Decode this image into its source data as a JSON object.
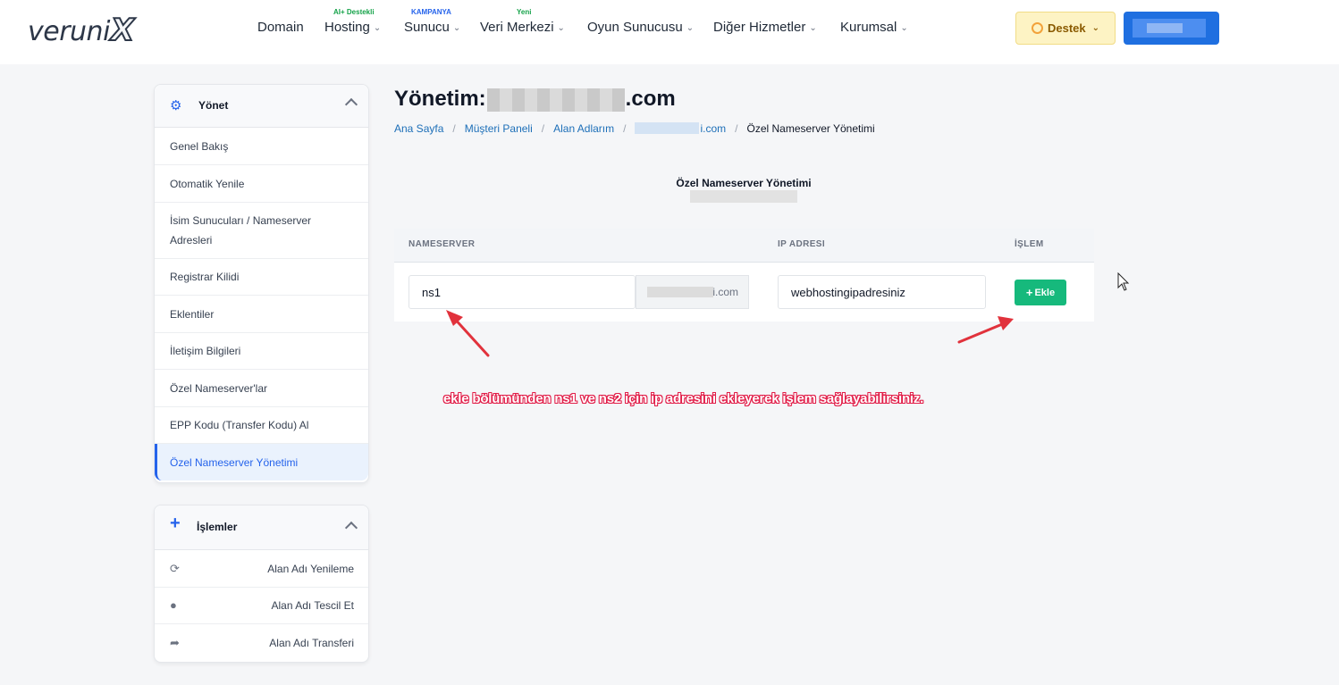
{
  "header": {
    "logo_text": "veruni",
    "logo_x": "X",
    "nav": [
      {
        "label": "Domain",
        "badge": ""
      },
      {
        "label": "Hosting",
        "badge": "AI+ Destekli",
        "badge_color": "#16a34a"
      },
      {
        "label": "Sunucu",
        "badge": "KAMPANYA",
        "badge_color": "#2563eb"
      },
      {
        "label": "Veri Merkezi",
        "badge": "Yeni",
        "badge_color": "#16a34a"
      },
      {
        "label": "Oyun Sunucusu",
        "badge": ""
      },
      {
        "label": "Diğer Hizmetler",
        "badge": ""
      },
      {
        "label": "Kurumsal",
        "badge": ""
      }
    ],
    "support_label": "Destek",
    "user_label": ""
  },
  "sidebar": {
    "manage": {
      "title": "Yönet",
      "items": [
        {
          "label": "Genel Bakış"
        },
        {
          "label": "Otomatik Yenile"
        },
        {
          "label": "İsim Sunucuları / Nameserver Adresleri"
        },
        {
          "label": "Registrar Kilidi"
        },
        {
          "label": "Eklentiler"
        },
        {
          "label": "İletişim Bilgileri"
        },
        {
          "label": "Özel Nameserver'lar"
        },
        {
          "label": "EPP Kodu (Transfer Kodu) Al"
        },
        {
          "label": "Özel Nameserver Yönetimi",
          "active": true
        }
      ]
    },
    "actions": {
      "title": "İşlemler",
      "items": [
        {
          "label": "Alan Adı Yenileme",
          "icon": "refresh-icon"
        },
        {
          "label": "Alan Adı Tescil Et",
          "icon": "globe-icon"
        },
        {
          "label": "Alan Adı Transferi",
          "icon": "share-icon"
        }
      ]
    }
  },
  "main": {
    "title_prefix": "Yönetim:",
    "title_suffix": ".com",
    "breadcrumb": {
      "home": "Ana Sayfa",
      "panel": "Müşteri Paneli",
      "domains": "Alan Adlarım",
      "domain_suffix": "i.com",
      "current": "Özel Nameserver Yönetimi"
    },
    "section_title": "Özel Nameserver Yönetimi",
    "table": {
      "col_nameserver": "NAMESERVER",
      "col_ip": "IP ADRESI",
      "col_action": "İŞLEM",
      "ns_value": "ns1",
      "domain_suffix": "i.com",
      "ip_value": "webhostingipadresiniz",
      "add_label": "Ekle"
    },
    "note": "ekle bölümünden ns1 ve ns2 için ip adresini ekleyerek işlem sağlayabilirsiniz."
  },
  "colors": {
    "accent": "#2563eb",
    "add_button": "#16b97c",
    "annotation": "#e11d48"
  }
}
